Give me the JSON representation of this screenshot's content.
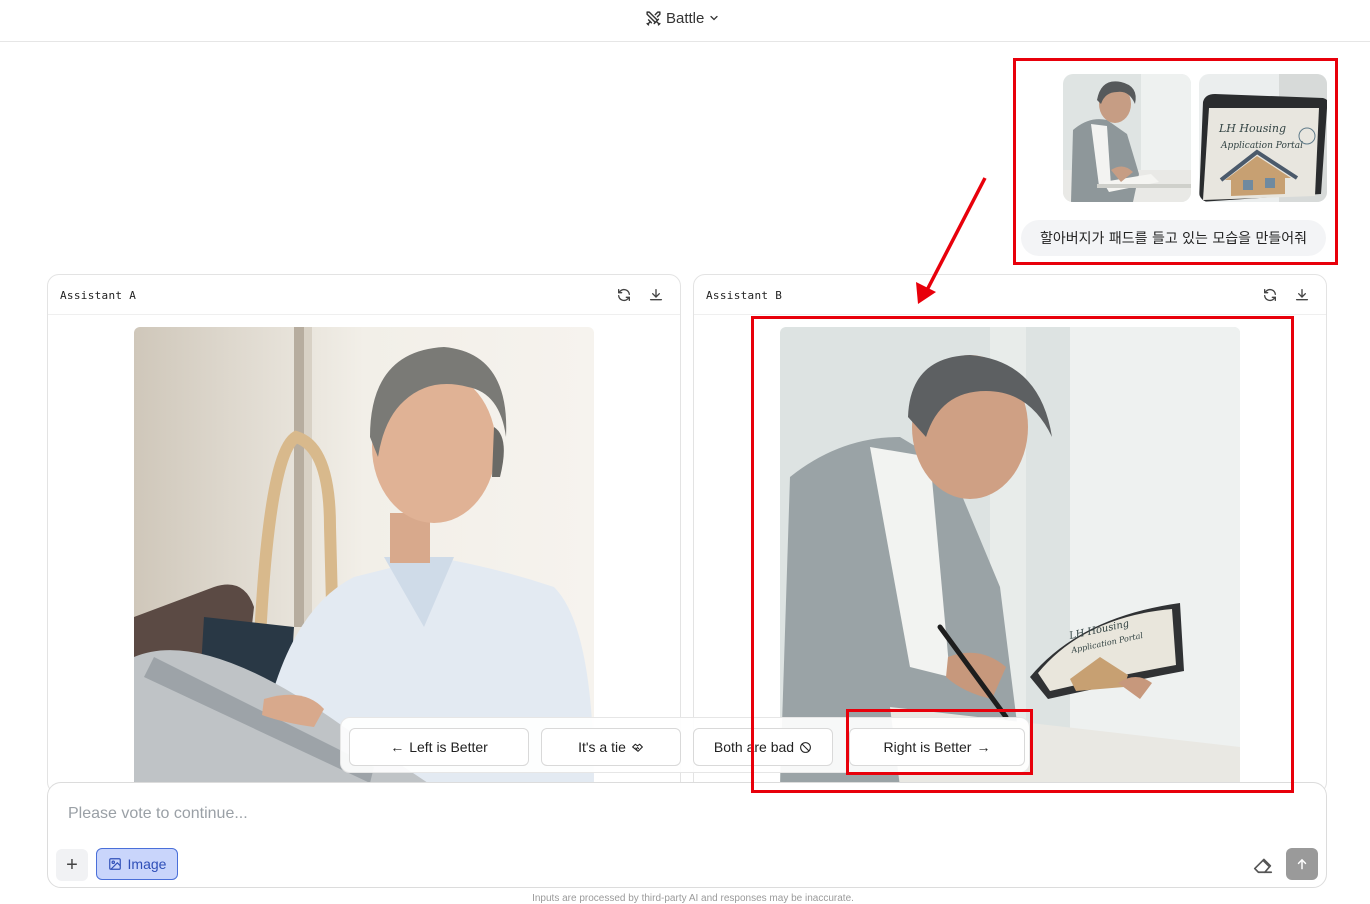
{
  "header": {
    "mode_label": "Battle"
  },
  "user_message": {
    "attachments": [
      {
        "name": "grandpa-writing-photo"
      },
      {
        "name": "tablet-housing-portal-photo",
        "caption_lines": [
          "LH Housing",
          "Application Portal"
        ]
      }
    ],
    "prompt_text": "할아버지가 패드를 들고 있는 모습을 만들어줘"
  },
  "panels": {
    "a": {
      "title": "Assistant A",
      "icons": [
        "refresh-icon",
        "download-icon"
      ]
    },
    "b": {
      "title": "Assistant B",
      "icons": [
        "refresh-icon",
        "download-icon"
      ],
      "tablet_text": [
        "LH Housing",
        "Application Portal"
      ]
    }
  },
  "vote": {
    "left_label": "Left is Better",
    "tie_label": "It's a tie",
    "bad_label": "Both are bad",
    "right_label": "Right is Better"
  },
  "composer": {
    "placeholder": "Please vote to continue...",
    "image_label": "Image",
    "plus_label": "+"
  },
  "footer": {
    "disclaimer": "Inputs are processed by third-party AI and responses may be inaccurate."
  },
  "colors": {
    "annotation": "#e8000b",
    "image_toggle_bg": "#c9d5fb",
    "image_toggle_text": "#2f4fb8",
    "send_bg": "#9a9a9a"
  }
}
